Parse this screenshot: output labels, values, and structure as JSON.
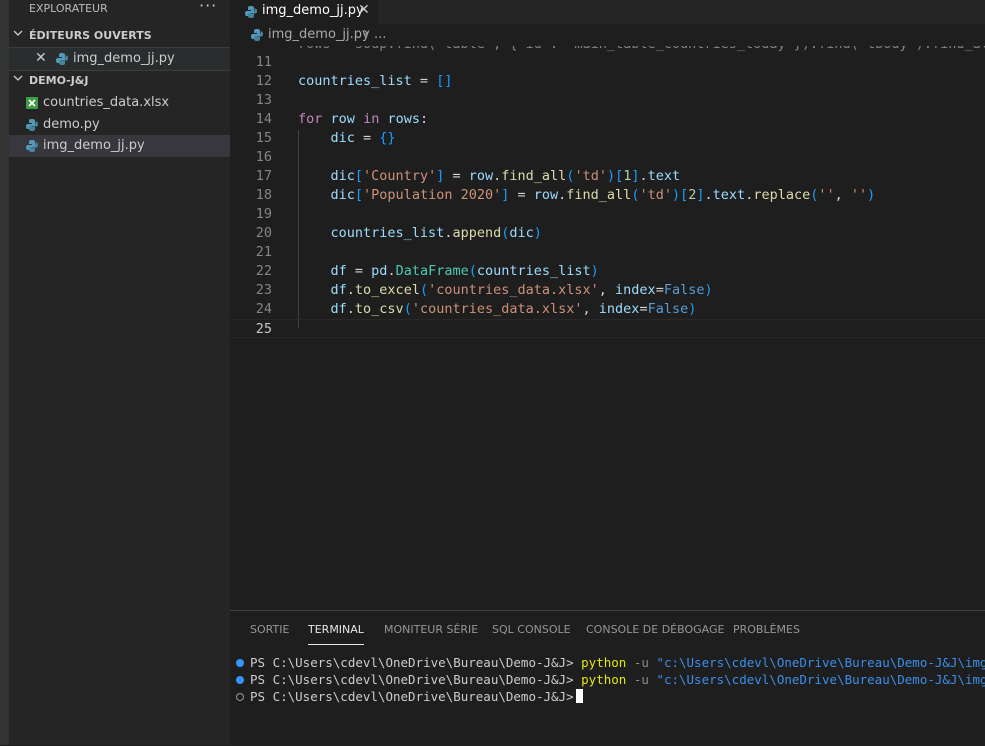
{
  "sidebar": {
    "title": "EXPLORATEUR",
    "more": "···",
    "open_editors": {
      "label": "ÉDITEURS OUVERTS",
      "items": [
        {
          "name": "img_demo_jj.py",
          "icon": "python-icon"
        }
      ]
    },
    "folder": {
      "label": "DEMO-J&J",
      "items": [
        {
          "name": "countries_data.xlsx",
          "icon": "excel-icon"
        },
        {
          "name": "demo.py",
          "icon": "python-icon"
        },
        {
          "name": "img_demo_jj.py",
          "icon": "python-icon"
        }
      ]
    }
  },
  "tabs": [
    {
      "label": "img_demo_jj.py",
      "close": "✕"
    }
  ],
  "breadcrumb": {
    "file": "img_demo_jj.py",
    "separator": "›",
    "more": "..."
  },
  "editor": {
    "line_numbers": [
      "11",
      "12",
      "13",
      "14",
      "15",
      "16",
      "17",
      "18",
      "19",
      "20",
      "21",
      "22",
      "23",
      "24",
      "25"
    ],
    "current_line": "25"
  },
  "panel": {
    "tabs": [
      "SORTIE",
      "TERMINAL",
      "MONITEUR SÉRIE",
      "SQL CONSOLE",
      "CONSOLE DE DÉBOGAGE",
      "PROBLÈMES"
    ],
    "active_tab": "TERMINAL",
    "terminal": {
      "prompt": "PS C:\\Users\\cdevl\\OneDrive\\Bureau\\Demo-J&J>",
      "command": "python",
      "flag": "-u",
      "arg": "\"c:\\Users\\cdevl\\OneDrive\\Bureau\\Demo-J&J\\img_demo_jj.py\""
    }
  },
  "colors": {
    "accent": "#007acc",
    "python_icon": "#519aba",
    "excel_icon": "#3e9c44",
    "keyword": "#c586c0",
    "variable": "#9cdcfe",
    "string": "#ce9178"
  }
}
